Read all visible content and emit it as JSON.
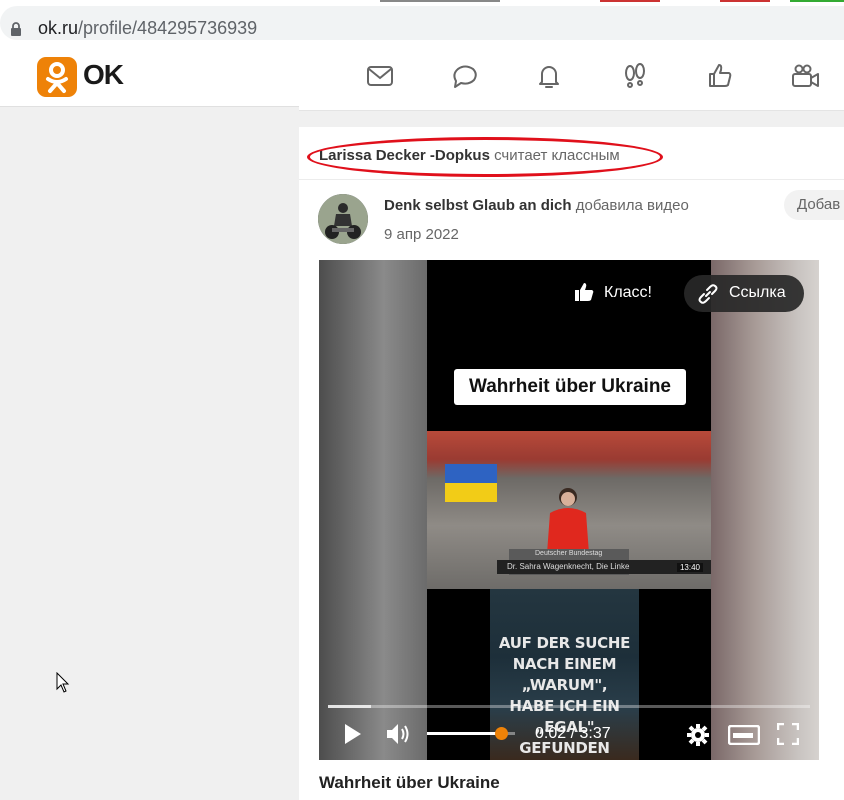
{
  "browser": {
    "url_host": "ok.ru",
    "url_path": "/profile/484295736939"
  },
  "header": {
    "logo_text": "OK",
    "brand_color": "#ee8208",
    "nav_icons": [
      "mail-icon",
      "messages-icon",
      "notifications-icon",
      "guests-icon",
      "likes-icon",
      "video-icon"
    ]
  },
  "feed": {
    "liked_by_name": "Larissa Decker -Dopkus",
    "liked_verb": "считает классным",
    "post": {
      "author": "Denk selbst Glaub an dich",
      "action": "добавила видео",
      "date": "9 апр 2022",
      "add_button": "Добав",
      "video": {
        "title_overlay": "Wahrheit über Ukraine",
        "like_label": "Класс!",
        "link_label": "Ссылка",
        "lower_third": "Dr. Sahra Wagenknecht, Die Linke",
        "lower_third_top": "Deutscher Bundestag",
        "clock": "13:40",
        "poster_lines": [
          "AUF DER SUCHE",
          "NACH EINEM „WARUM\",",
          "HABE ICH EIN „EGAL\"",
          "GEFUNDEN"
        ],
        "time_display": "0:02 / 3:37",
        "progress": 0.09,
        "volume": 0.84
      },
      "caption": "Wahrheit über Ukraine"
    }
  }
}
